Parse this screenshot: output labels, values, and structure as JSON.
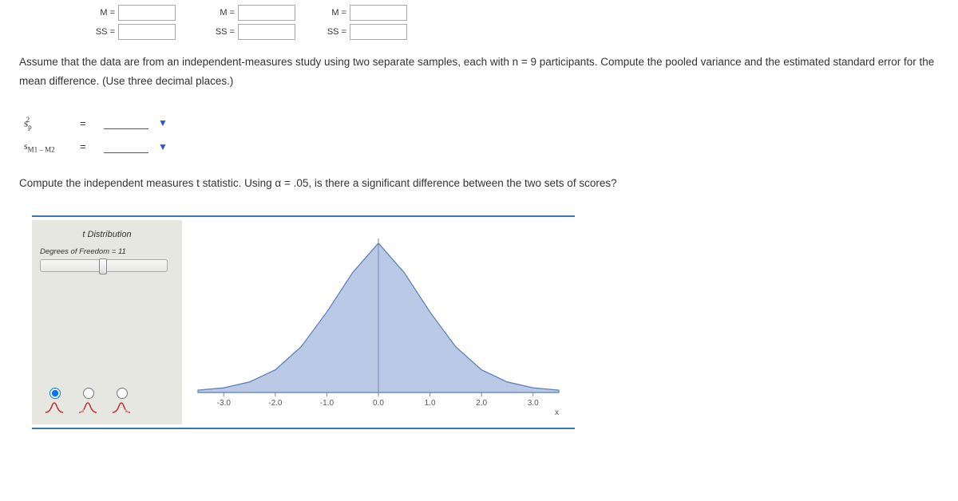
{
  "inputs": {
    "row1_label": "M =",
    "row2_label": "SS ="
  },
  "para1": "Assume that the data are from an independent-measures study using two separate samples, each with n = 9 participants. Compute the pooled variance and the estimated standard error for the mean difference. (Use three decimal places.)",
  "formula": {
    "sp2_html": "s<sub>p</sub><sup style='margin-left:-7px'>2</sup>",
    "sm_html": "s<sub>M1 – M2</sub>",
    "eq": "="
  },
  "para2": "Compute the independent measures t statistic. Using α = .05, is there a significant difference between the two sets of scores?",
  "dist": {
    "title": "t Distribution",
    "dof": "Degrees of Freedom = 11",
    "axis_label": "x"
  },
  "chart_data": {
    "type": "line",
    "title": "t Distribution",
    "xlabel": "x",
    "ylabel": "",
    "xlim": [
      -3.5,
      3.5
    ],
    "ylim": [
      0,
      0.4
    ],
    "x_ticks": [
      -3.0,
      -2.0,
      -1.0,
      0.0,
      1.0,
      2.0,
      3.0
    ],
    "series": [
      {
        "name": "t pdf (df=11)",
        "x": [
          -3.5,
          -3.0,
          -2.5,
          -2.0,
          -1.5,
          -1.0,
          -0.5,
          0.0,
          0.5,
          1.0,
          1.5,
          2.0,
          2.5,
          3.0,
          3.5
        ],
        "values": [
          0.006,
          0.012,
          0.027,
          0.058,
          0.117,
          0.206,
          0.307,
          0.382,
          0.307,
          0.206,
          0.117,
          0.058,
          0.027,
          0.012,
          0.006
        ]
      }
    ]
  }
}
